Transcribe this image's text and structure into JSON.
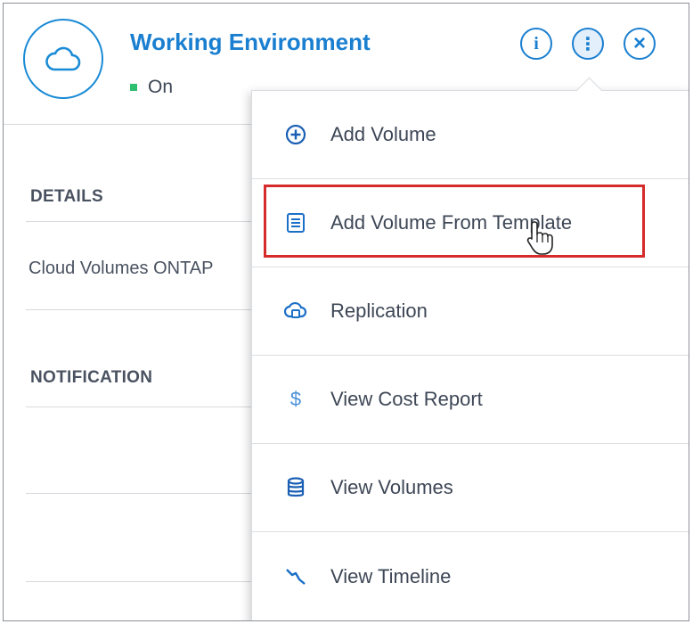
{
  "header": {
    "title": "Working Environment",
    "status": "On",
    "status_color": "#2fbf71",
    "accent_color": "#1a7fd0",
    "buttons": [
      {
        "name": "info-icon",
        "glyph": "i"
      },
      {
        "name": "more-vertical-icon",
        "glyph": "⋮"
      },
      {
        "name": "close-icon",
        "glyph": "×"
      }
    ]
  },
  "details": {
    "label": "DETAILS",
    "value": "Cloud Volumes ONTAP"
  },
  "notification": {
    "label": "NOTIFICATION"
  },
  "menu": {
    "items": [
      {
        "label": "Add Volume",
        "icon": "add-circle-icon"
      },
      {
        "label": "Add Volume From Template",
        "icon": "document-icon",
        "highlighted": true
      },
      {
        "label": "Replication",
        "icon": "replication-icon"
      },
      {
        "label": "View Cost Report",
        "icon": "dollar-icon"
      },
      {
        "label": "View Volumes",
        "icon": "database-icon"
      },
      {
        "label": "View Timeline",
        "icon": "timeline-icon"
      }
    ],
    "highlight_color": "#d52b2b"
  }
}
